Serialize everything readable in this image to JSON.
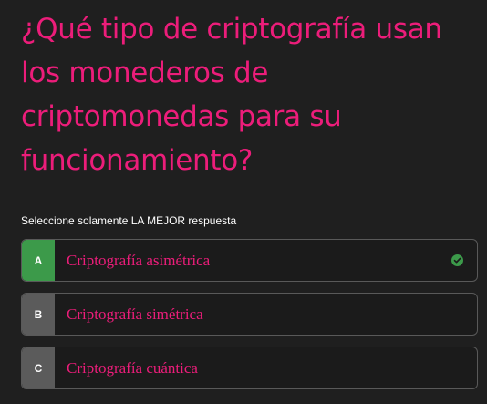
{
  "question": {
    "title": "¿Qué tipo de criptografía usan los monederos de criptomonedas para su funcionamiento?"
  },
  "instruction": "Seleccione solamente LA MEJOR respuesta",
  "options": [
    {
      "letter": "A",
      "label": "Criptografía asimétrica",
      "selected": true,
      "letter_bg": "#3c9a4a",
      "icon": "check-circle-icon"
    },
    {
      "letter": "B",
      "label": "Criptografía simétrica",
      "selected": false,
      "letter_bg": "#5b5b5b"
    },
    {
      "letter": "C",
      "label": "Criptografía cuántica",
      "selected": false,
      "letter_bg": "#5b5b5b"
    }
  ],
  "colors": {
    "background": "#1f1f1f",
    "accent": "#ec1d7a",
    "correct": "#3c9a4a",
    "neutral": "#5b5b5b"
  }
}
